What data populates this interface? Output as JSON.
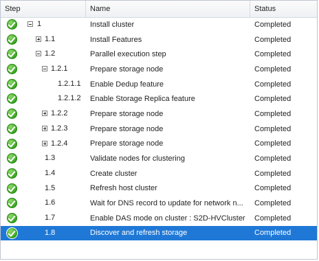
{
  "columns": {
    "step": "Step",
    "name": "Name",
    "status": "Status"
  },
  "rows": [
    {
      "step": "1",
      "name": "Install cluster",
      "status": "Completed",
      "expander": "minus"
    },
    {
      "step": "1.1",
      "name": "Install Features",
      "status": "Completed",
      "expander": "plus"
    },
    {
      "step": "1.2",
      "name": "Parallel execution step",
      "status": "Completed",
      "expander": "minus"
    },
    {
      "step": "1.2.1",
      "name": "Prepare storage node",
      "status": "Completed",
      "expander": "minus"
    },
    {
      "step": "1.2.1.1",
      "name": "Enable Dedup feature",
      "status": "Completed",
      "expander": ""
    },
    {
      "step": "1.2.1.2",
      "name": "Enable Storage Replica feature",
      "status": "Completed",
      "expander": ""
    },
    {
      "step": "1.2.2",
      "name": "Prepare storage node",
      "status": "Completed",
      "expander": "plus"
    },
    {
      "step": "1.2.3",
      "name": "Prepare storage node",
      "status": "Completed",
      "expander": "plus"
    },
    {
      "step": "1.2.4",
      "name": "Prepare storage node",
      "status": "Completed",
      "expander": "plus"
    },
    {
      "step": "1.3",
      "name": "Validate nodes for clustering",
      "status": "Completed",
      "expander": ""
    },
    {
      "step": "1.4",
      "name": "Create cluster",
      "status": "Completed",
      "expander": ""
    },
    {
      "step": "1.5",
      "name": "Refresh host cluster",
      "status": "Completed",
      "expander": ""
    },
    {
      "step": "1.6",
      "name": "Wait for DNS record to update for network n...",
      "status": "Completed",
      "expander": ""
    },
    {
      "step": "1.7",
      "name": "Enable DAS mode on cluster : S2D-HVCluster",
      "status": "Completed",
      "expander": ""
    },
    {
      "step": "1.8",
      "name": "Discover and refresh storage",
      "status": "Completed",
      "expander": "",
      "selected": true
    }
  ],
  "icons": {
    "status_icon": "check-circle-icon"
  },
  "colors": {
    "selection": "#1f78d6",
    "check_green": "#36a11e"
  }
}
